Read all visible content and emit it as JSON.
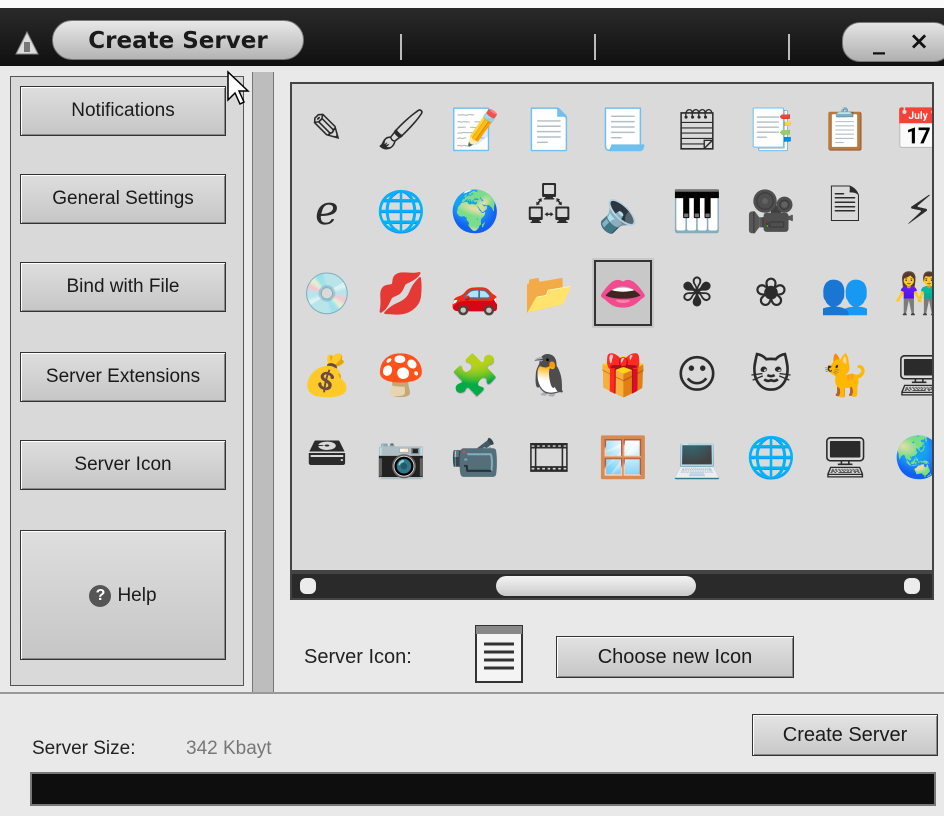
{
  "window": {
    "title": "Create Server",
    "minimize_label": "_",
    "close_label": "×"
  },
  "sidebar": {
    "items": [
      {
        "label": "Notifications"
      },
      {
        "label": "General Settings"
      },
      {
        "label": "Bind with File"
      },
      {
        "label": "Server Extensions"
      },
      {
        "label": "Server Icon"
      }
    ],
    "help": {
      "icon": "?",
      "label": "Help"
    }
  },
  "icon_picker": {
    "rows": [
      [
        {
          "name": "pencil-cup-icon",
          "glyph": "✎"
        },
        {
          "name": "paint-book-icon",
          "glyph": "🖌"
        },
        {
          "name": "notepad-pencil-icon",
          "glyph": "📝"
        },
        {
          "name": "document-lines-icon",
          "glyph": "📄"
        },
        {
          "name": "document-gear-icon",
          "glyph": "📃"
        },
        {
          "name": "spiral-notepad-icon",
          "glyph": "🗒"
        },
        {
          "name": "document-font-icon",
          "glyph": "📑"
        },
        {
          "name": "document-puzzle-icon",
          "glyph": "📋"
        },
        {
          "name": "calendar-icon",
          "glyph": "📅"
        }
      ],
      [
        {
          "name": "internet-explorer-icon",
          "glyph": "ℯ"
        },
        {
          "name": "globe-network-icon",
          "glyph": "🌐"
        },
        {
          "name": "globe-icon",
          "glyph": "🌍"
        },
        {
          "name": "network-tree-icon",
          "glyph": "🖧"
        },
        {
          "name": "audio-file-icon",
          "glyph": "🔈"
        },
        {
          "name": "midi-file-icon",
          "glyph": "🎹"
        },
        {
          "name": "video-file-icon",
          "glyph": "🎥"
        },
        {
          "name": "shortcut-file-icon",
          "glyph": "🗎"
        },
        {
          "name": "winamp-icon",
          "glyph": "⚡"
        }
      ],
      [
        {
          "name": "software-box-cd-icon",
          "glyph": "💿"
        },
        {
          "name": "folder-lips-icon",
          "glyph": "💋"
        },
        {
          "name": "folder-car-icon",
          "glyph": "🚗"
        },
        {
          "name": "folder-open-icon",
          "glyph": "📂"
        },
        {
          "name": "lips-icon",
          "glyph": "👄"
        },
        {
          "name": "folder-flower-icon",
          "glyph": "✾"
        },
        {
          "name": "flower-icon",
          "glyph": "❀"
        },
        {
          "name": "users-group-icon",
          "glyph": "👥"
        },
        {
          "name": "users-pair-icon",
          "glyph": "👫"
        }
      ],
      [
        {
          "name": "money-bag-icon",
          "glyph": "💰"
        },
        {
          "name": "mario-icon",
          "glyph": "🍄"
        },
        {
          "name": "puzzle-icon",
          "glyph": "🧩"
        },
        {
          "name": "tux-penguin-icon",
          "glyph": "🐧"
        },
        {
          "name": "gift-box-icon",
          "glyph": "🎁"
        },
        {
          "name": "smiley-icon",
          "glyph": "☺"
        },
        {
          "name": "garfield-icon",
          "glyph": "🐱"
        },
        {
          "name": "flying-cat-icon",
          "glyph": "🐈"
        },
        {
          "name": "mac-computer-icon",
          "glyph": "🖥"
        }
      ],
      [
        {
          "name": "hard-drive-icon",
          "glyph": "🖴"
        },
        {
          "name": "camera-icon",
          "glyph": "📷"
        },
        {
          "name": "camcorder-icon",
          "glyph": "📹"
        },
        {
          "name": "film-folder-icon",
          "glyph": "🎞"
        },
        {
          "name": "windows-monitor-icon",
          "glyph": "🪟"
        },
        {
          "name": "computer-monitor-icon",
          "glyph": "💻"
        },
        {
          "name": "windows-globe-icon",
          "glyph": "🌐"
        },
        {
          "name": "network-computer-icon",
          "glyph": "🖥"
        },
        {
          "name": "internet-globe-icon",
          "glyph": "🌏"
        }
      ]
    ],
    "selected": {
      "row": 2,
      "col": 4
    }
  },
  "selection": {
    "label": "Server Icon:",
    "choose_button": "Choose new Icon"
  },
  "footer": {
    "size_label": "Server Size:",
    "size_value": "342 Kbayt",
    "create_button": "Create Server"
  }
}
